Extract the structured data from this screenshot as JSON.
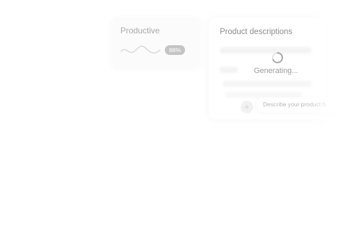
{
  "productive_card": {
    "title": "Productive",
    "percent": "88%",
    "trend_icon": "wave-sparkline-icon"
  },
  "description_card": {
    "title": "Product descriptions",
    "status": "Generating...",
    "spinner_icon": "spinner-icon"
  },
  "prompt": {
    "placeholder": "Describe your product h",
    "send_icon": "sparkle-icon"
  },
  "colors": {
    "badge": "#c4c4c4",
    "muted_text": "#a9a9a9",
    "placeholder": "#b8b8b8"
  }
}
